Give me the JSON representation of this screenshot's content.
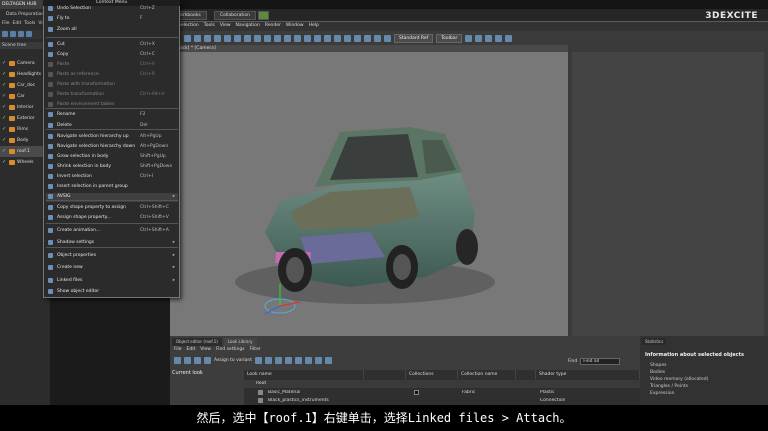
{
  "app": {
    "title": "DELTAGEN HUB",
    "window_title": "Data Preparation",
    "menu": [
      "File",
      "Edit",
      "Tools",
      "View"
    ],
    "tab": "Scene tree"
  },
  "tree": {
    "items": [
      {
        "label": "Camera"
      },
      {
        "label": "Headlights"
      },
      {
        "label": "Car_doc"
      },
      {
        "label": "Car"
      },
      {
        "label": "Interior"
      },
      {
        "label": "Exterior"
      },
      {
        "label": "Rims"
      },
      {
        "label": "Body"
      },
      {
        "label": "roof.1"
      },
      {
        "label": "Wheels"
      }
    ]
  },
  "context_menu": {
    "title": "Context Menu",
    "items": [
      {
        "label": "Undo Selection",
        "shortcut": "Ctrl+Z",
        "disabled": false,
        "submenu": false
      },
      {
        "label": "Fly to",
        "shortcut": "F",
        "disabled": false,
        "submenu": false
      },
      {
        "label": "Zoom all",
        "shortcut": "",
        "disabled": false,
        "submenu": false
      },
      {
        "label": "Cut",
        "shortcut": "Ctrl+X",
        "disabled": false,
        "submenu": false
      },
      {
        "label": "Copy",
        "shortcut": "Ctrl+C",
        "disabled": false,
        "submenu": false
      },
      {
        "label": "Paste",
        "shortcut": "Ctrl+V",
        "disabled": true,
        "submenu": false
      },
      {
        "label": "Paste as reference",
        "shortcut": "Ctrl+R",
        "disabled": true,
        "submenu": false
      },
      {
        "label": "Paste with transformation",
        "shortcut": "",
        "disabled": true,
        "submenu": false
      },
      {
        "label": "Paste transformation",
        "shortcut": "Ctrl+Alt+V",
        "disabled": true,
        "submenu": false
      },
      {
        "label": "Paste environment tables",
        "shortcut": "",
        "disabled": true,
        "submenu": false
      },
      {
        "label": "Rename",
        "shortcut": "F2",
        "disabled": false,
        "submenu": false
      },
      {
        "label": "Delete",
        "shortcut": "Del",
        "disabled": false,
        "submenu": false
      },
      {
        "label": "Navigate selection hierarchy up",
        "shortcut": "Alt+PgUp",
        "disabled": false,
        "submenu": false
      },
      {
        "label": "Navigate selection hierarchy down",
        "shortcut": "Alt+PgDown",
        "disabled": false,
        "submenu": false
      },
      {
        "label": "Grow selection in body",
        "shortcut": "Shift+PgUp",
        "disabled": false,
        "submenu": false
      },
      {
        "label": "Shrink selection in body",
        "shortcut": "Shift+PgDown",
        "disabled": false,
        "submenu": false
      },
      {
        "label": "Invert selection",
        "shortcut": "Ctrl+I",
        "disabled": false,
        "submenu": false
      },
      {
        "label": "Insert selection in parent group",
        "shortcut": "",
        "disabled": false,
        "submenu": false
      },
      {
        "label": "AVSIG",
        "shortcut": "",
        "disabled": false,
        "submenu": true
      },
      {
        "label": "Copy shape property to assign",
        "shortcut": "Ctrl+Shift+C",
        "disabled": false,
        "submenu": false
      },
      {
        "label": "Assign shape property...",
        "shortcut": "Ctrl+Shift+V",
        "disabled": false,
        "submenu": false
      },
      {
        "label": "Create animation...",
        "shortcut": "Ctrl+Shift+A",
        "disabled": false,
        "submenu": false
      },
      {
        "label": "Shadow settings",
        "shortcut": "",
        "disabled": false,
        "submenu": true
      },
      {
        "label": "Object properties",
        "shortcut": "",
        "disabled": false,
        "submenu": true
      },
      {
        "label": "Create new",
        "shortcut": "",
        "disabled": false,
        "submenu": true
      },
      {
        "label": "Linked files",
        "shortcut": "",
        "disabled": false,
        "submenu": true
      },
      {
        "label": "Show object editor",
        "shortcut": "",
        "disabled": false,
        "submenu": false
      }
    ]
  },
  "workspace": {
    "tabs": [
      "Workbooks",
      "Collaboration"
    ],
    "brand": "3DEXCITE",
    "menu": [
      "Selection",
      "Tools",
      "View",
      "Navigation",
      "Render",
      "Window",
      "Help"
    ],
    "toolbar_buttons": [
      "Standard Ref",
      "Toolbar"
    ],
    "viewport_title": "[Back] * [Camera]"
  },
  "bottom": {
    "tabs": [
      "Object editor (roof.1)",
      "Look Library"
    ],
    "menu": [
      "File",
      "Edit",
      "View",
      "Find settings",
      "Filter"
    ],
    "assign_label": "Assign to variant",
    "find_label": "Find",
    "find_value": "Find all",
    "current_look": "Current look",
    "columns": [
      "Look name",
      "Collections",
      "Collection name",
      "Shader type"
    ],
    "rows": [
      {
        "name": "Root",
        "collection": "",
        "collection_name": "",
        "shader": ""
      },
      {
        "name": "Basic_Material",
        "collection": "",
        "collection_name": "Fabric",
        "shader": "Plastic"
      },
      {
        "name": "Black_plastics_instruments",
        "collection": "",
        "collection_name": "",
        "shader": "Connection"
      }
    ]
  },
  "info_panel": {
    "tab": "Statistics",
    "title": "Information about selected objects",
    "lines": [
      "Shapes",
      "Bodies",
      "Video memory (allocated)",
      "Triangles / Points",
      "Expression"
    ]
  },
  "subtitle": "然后，选中【roof.1】右键单击，选择Linked files > Attach。",
  "colors": {
    "accent": "#d98b2d",
    "menu_bg": "#2b2b2b",
    "car": "#4d6b63"
  }
}
